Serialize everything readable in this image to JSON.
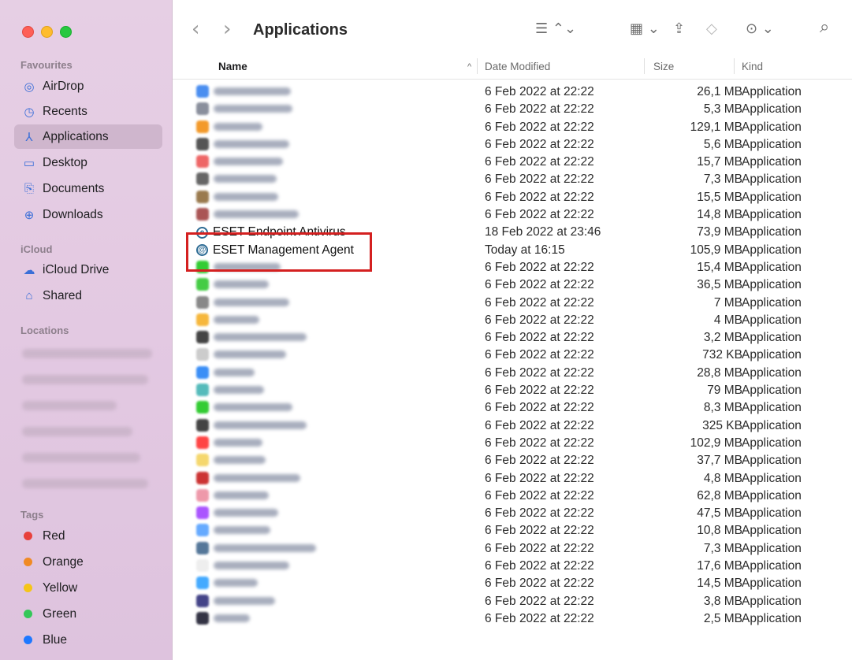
{
  "window": {
    "title": "Applications"
  },
  "toolbar": {
    "back_icon": "chevron-left-icon",
    "forward_icon": "chevron-right-icon",
    "list_view_glyph": "☰ ⌃⌄",
    "group_glyph": "▦ ⌄",
    "share_glyph": "⇪",
    "tag_glyph": "◇",
    "more_glyph": "⊙ ⌄",
    "search_glyph": "⌕"
  },
  "sidebar": {
    "favourites_title": "Favourites",
    "favourites": [
      {
        "label": "AirDrop",
        "icon": "airdrop-icon"
      },
      {
        "label": "Recents",
        "icon": "clock-icon"
      },
      {
        "label": "Applications",
        "icon": "applications-icon",
        "active": true
      },
      {
        "label": "Desktop",
        "icon": "desktop-icon"
      },
      {
        "label": "Documents",
        "icon": "document-icon"
      },
      {
        "label": "Downloads",
        "icon": "download-icon"
      }
    ],
    "icloud_title": "iCloud",
    "icloud": [
      {
        "label": "iCloud Drive",
        "icon": "cloud-icon"
      },
      {
        "label": "Shared",
        "icon": "shared-folder-icon"
      }
    ],
    "locations_title": "Locations",
    "tags_title": "Tags",
    "tags": [
      {
        "label": "Red",
        "color": "#e8413c"
      },
      {
        "label": "Orange",
        "color": "#f08a24"
      },
      {
        "label": "Yellow",
        "color": "#f5c518"
      },
      {
        "label": "Green",
        "color": "#34c759"
      },
      {
        "label": "Blue",
        "color": "#1e78ff"
      }
    ]
  },
  "list": {
    "columns": {
      "name": "Name",
      "date": "Date Modified",
      "size": "Size",
      "kind": "Kind",
      "sort_glyph": "^"
    },
    "rows": [
      {
        "name": "",
        "date": "6 Feb 2022 at 22:22",
        "size": "26,1 MB",
        "kind": "Application",
        "icon_color": "#4a8ef0"
      },
      {
        "name": "",
        "date": "6 Feb 2022 at 22:22",
        "size": "5,3 MB",
        "kind": "Application",
        "icon_color": "#8a8f9c"
      },
      {
        "name": "",
        "date": "6 Feb 2022 at 22:22",
        "size": "129,1 MB",
        "kind": "Application",
        "icon_color": "#f39a2b"
      },
      {
        "name": "",
        "date": "6 Feb 2022 at 22:22",
        "size": "5,6 MB",
        "kind": "Application",
        "icon_color": "#555"
      },
      {
        "name": "",
        "date": "6 Feb 2022 at 22:22",
        "size": "15,7 MB",
        "kind": "Application",
        "icon_color": "#e66"
      },
      {
        "name": "",
        "date": "6 Feb 2022 at 22:22",
        "size": "7,3 MB",
        "kind": "Application",
        "icon_color": "#666"
      },
      {
        "name": "",
        "date": "6 Feb 2022 at 22:22",
        "size": "15,5 MB",
        "kind": "Application",
        "icon_color": "#9a7a4e"
      },
      {
        "name": "",
        "date": "6 Feb 2022 at 22:22",
        "size": "14,8 MB",
        "kind": "Application",
        "icon_color": "#a55"
      },
      {
        "name": "ESET Endpoint Antivirus",
        "date": "18 Feb 2022 at 23:46",
        "size": "73,9 MB",
        "kind": "Application",
        "eset": "e"
      },
      {
        "name": "ESET Management Agent",
        "date": "Today at 16:15",
        "size": "105,9 MB",
        "kind": "Application",
        "eset": "@"
      },
      {
        "name": "",
        "date": "6 Feb 2022 at 22:22",
        "size": "15,4 MB",
        "kind": "Application",
        "icon_color": "#3c3"
      },
      {
        "name": "",
        "date": "6 Feb 2022 at 22:22",
        "size": "36,5 MB",
        "kind": "Application",
        "icon_color": "#4c4"
      },
      {
        "name": "",
        "date": "6 Feb 2022 at 22:22",
        "size": "7 MB",
        "kind": "Application",
        "icon_color": "#888"
      },
      {
        "name": "",
        "date": "6 Feb 2022 at 22:22",
        "size": "4 MB",
        "kind": "Application",
        "icon_color": "#f6b73c"
      },
      {
        "name": "",
        "date": "6 Feb 2022 at 22:22",
        "size": "3,2 MB",
        "kind": "Application",
        "icon_color": "#444"
      },
      {
        "name": "",
        "date": "6 Feb 2022 at 22:22",
        "size": "732 KB",
        "kind": "Application",
        "icon_color": "#ccc"
      },
      {
        "name": "",
        "date": "6 Feb 2022 at 22:22",
        "size": "28,8 MB",
        "kind": "Application",
        "icon_color": "#3a8ef6"
      },
      {
        "name": "",
        "date": "6 Feb 2022 at 22:22",
        "size": "79 MB",
        "kind": "Application",
        "icon_color": "#5bb"
      },
      {
        "name": "",
        "date": "6 Feb 2022 at 22:22",
        "size": "8,3 MB",
        "kind": "Application",
        "icon_color": "#3c3"
      },
      {
        "name": "",
        "date": "6 Feb 2022 at 22:22",
        "size": "325 KB",
        "kind": "Application",
        "icon_color": "#444"
      },
      {
        "name": "",
        "date": "6 Feb 2022 at 22:22",
        "size": "102,9 MB",
        "kind": "Application",
        "icon_color": "#f44"
      },
      {
        "name": "",
        "date": "6 Feb 2022 at 22:22",
        "size": "37,7 MB",
        "kind": "Application",
        "icon_color": "#f5d76e"
      },
      {
        "name": "",
        "date": "6 Feb 2022 at 22:22",
        "size": "4,8 MB",
        "kind": "Application",
        "icon_color": "#c33"
      },
      {
        "name": "",
        "date": "6 Feb 2022 at 22:22",
        "size": "62,8 MB",
        "kind": "Application",
        "icon_color": "#e9a"
      },
      {
        "name": "",
        "date": "6 Feb 2022 at 22:22",
        "size": "47,5 MB",
        "kind": "Application",
        "icon_color": "#a5f"
      },
      {
        "name": "",
        "date": "6 Feb 2022 at 22:22",
        "size": "10,8 MB",
        "kind": "Application",
        "icon_color": "#6af"
      },
      {
        "name": "",
        "date": "6 Feb 2022 at 22:22",
        "size": "7,3 MB",
        "kind": "Application",
        "icon_color": "#579"
      },
      {
        "name": "",
        "date": "6 Feb 2022 at 22:22",
        "size": "17,6 MB",
        "kind": "Application",
        "icon_color": "#eee"
      },
      {
        "name": "",
        "date": "6 Feb 2022 at 22:22",
        "size": "14,5 MB",
        "kind": "Application",
        "icon_color": "#4af"
      },
      {
        "name": "",
        "date": "6 Feb 2022 at 22:22",
        "size": "3,8 MB",
        "kind": "Application",
        "icon_color": "#448"
      },
      {
        "name": "",
        "date": "6 Feb 2022 at 22:22",
        "size": "2,5 MB",
        "kind": "Application",
        "icon_color": "#334"
      }
    ]
  }
}
